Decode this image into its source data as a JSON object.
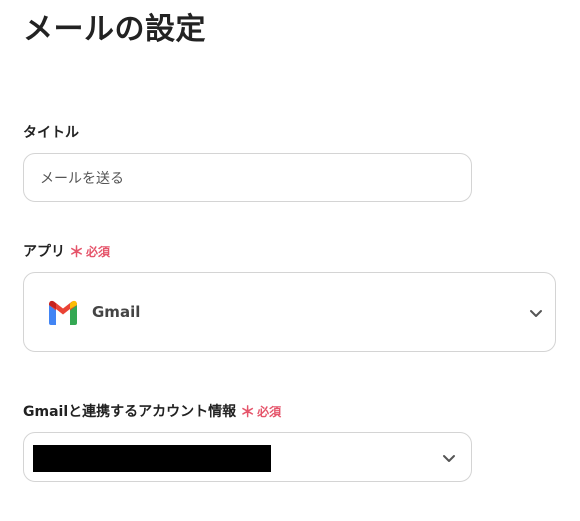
{
  "page": {
    "title": "メールの設定"
  },
  "fields": {
    "title": {
      "label": "タイトル",
      "value": "メールを送る"
    },
    "app": {
      "label": "アプリ",
      "required_mark": "＊",
      "required_text": "必須",
      "selected_app": "Gmail",
      "icon": "gmail-logo"
    },
    "account": {
      "label": "Gmailと連携するアカウント情報",
      "required_mark": "＊",
      "required_text": "必須",
      "value_redacted": true
    }
  },
  "colors": {
    "required": "#e5546a",
    "border": "#d4d4d4",
    "text": "#222222"
  }
}
